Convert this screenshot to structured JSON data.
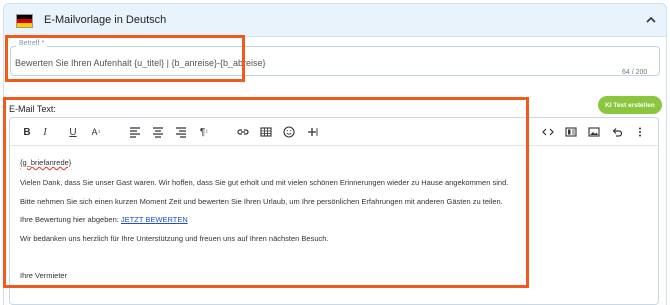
{
  "accordion": {
    "title": "E-Mailvorlage in Deutsch"
  },
  "subject": {
    "label": "Betreff *",
    "value": "Bewerten Sie Ihren Aufenhalt {u_titel} | {b_anreise}-{b_abreise}",
    "char_count": "64 / 200"
  },
  "email": {
    "label": "E-Mail Text:",
    "ai_button": "KI Text erstellen",
    "body": {
      "salutation": "{g_briefanrede}",
      "line1": "Vielen Dank, dass Sie unser Gast waren. Wir hoffen, dass Sie gut erholt und mit vielen schönen Erinnerungen wieder zu Hause angekommen sind.",
      "line2": "Bitte nehmen Sie sich einen kurzen Moment Zeit und bewerten Sie Ihren Urlaub, um Ihre persönlichen Erfahrungen mit anderen Gästen zu teilen.",
      "line3_prefix": "Ihre Bewertung hier abgeben:",
      "line3_link": "JETZT BEWERTEN",
      "line4": "Wir bedanken uns herzlich für Ihre Unterstützung und freuen uns auf Ihren nächsten Besuch.",
      "signature": "Ihre Vermieter"
    }
  },
  "colors": {
    "accent_green": "#8cc63f",
    "annotation_orange": "#f05a1a",
    "header_bg": "#e9f3fc",
    "link_blue": "#1a4fd6"
  },
  "icons": {
    "flag": "germany-flag-icon",
    "collapse": "chevron-up-icon"
  }
}
